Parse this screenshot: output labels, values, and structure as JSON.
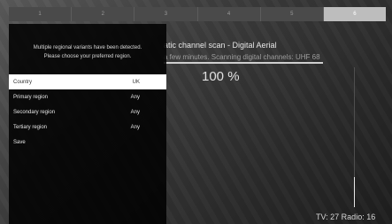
{
  "steps": [
    "1",
    "2",
    "3",
    "4",
    "5",
    "6"
  ],
  "active_step": 6,
  "scan": {
    "title": "atic channel scan - Digital Aerial",
    "status": "a few minutes. Scanning digital channels: UHF 68",
    "percent": "100 %",
    "progress": 1.0,
    "counts": "TV: 27  Radio: 16"
  },
  "dialog": {
    "message_line1": "Multiple regional variants have been detected.",
    "message_line2": "Please choose your preferred region.",
    "items": [
      {
        "label": "Country",
        "value": "UK"
      },
      {
        "label": "Primary region",
        "value": "Any"
      },
      {
        "label": "Secondary region",
        "value": "Any"
      },
      {
        "label": "Tertiary region",
        "value": "Any"
      },
      {
        "label": "Save",
        "value": ""
      }
    ],
    "selected_index": 0
  }
}
